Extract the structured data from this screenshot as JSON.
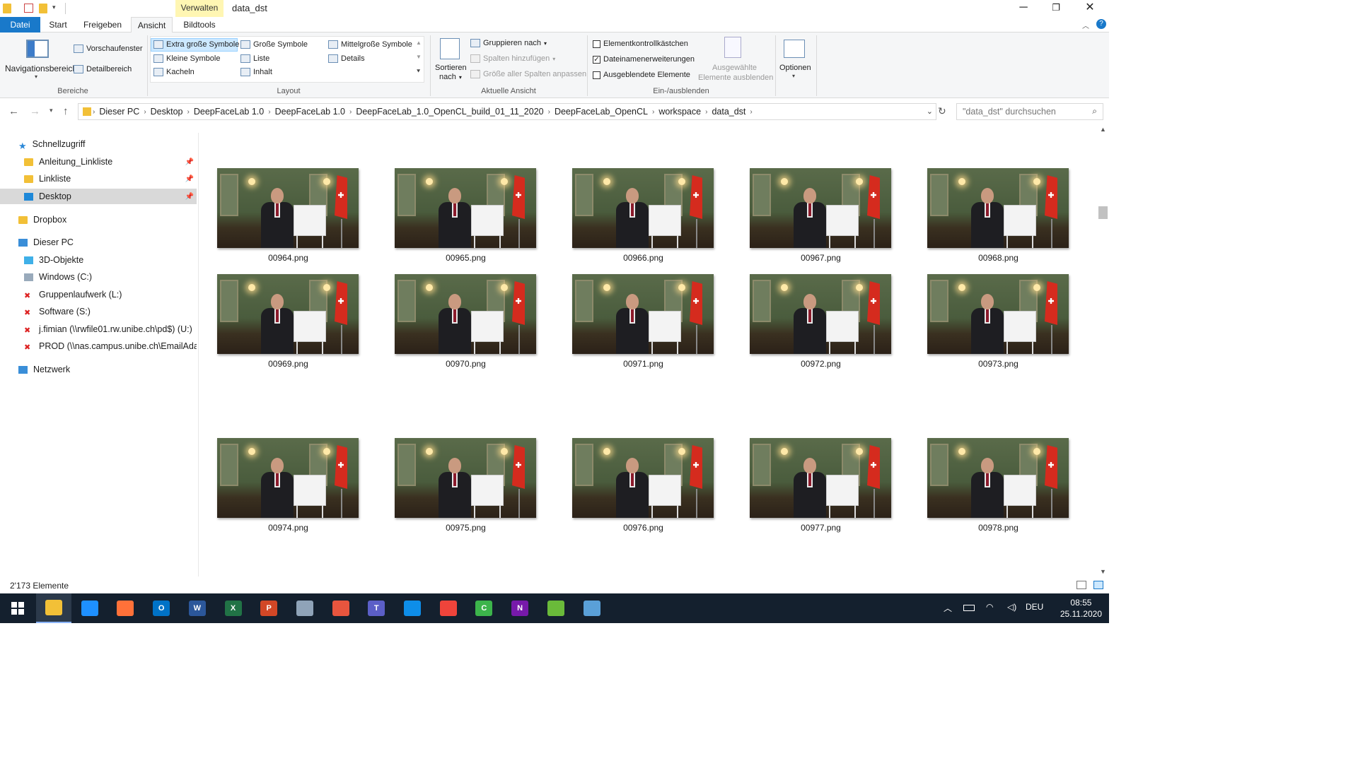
{
  "title_bar": {
    "context_group": "Verwalten",
    "window_title": "data_dst"
  },
  "tabs": [
    {
      "label": "Datei",
      "active": false
    },
    {
      "label": "Start",
      "active": false
    },
    {
      "label": "Freigeben",
      "active": false
    },
    {
      "label": "Ansicht",
      "active": true
    },
    {
      "label": "Bildtools",
      "active": false
    }
  ],
  "ribbon": {
    "panes": {
      "nav_pane": "Navigationsbereich",
      "preview": "Vorschaufenster",
      "details_pane": "Detailbereich",
      "group": "Bereiche"
    },
    "layout": {
      "options": [
        "Extra große Symbole",
        "Große Symbole",
        "Mittelgroße Symbole",
        "Kleine Symbole",
        "Liste",
        "Details",
        "Kacheln",
        "Inhalt"
      ],
      "selected": "Extra große Symbole",
      "group": "Layout"
    },
    "current_view": {
      "sort_line1": "Sortieren",
      "sort_line2": "nach",
      "group_by": "Gruppieren nach",
      "add_columns": "Spalten hinzufügen",
      "fit_columns": "Größe aller Spalten anpassen",
      "group": "Aktuelle Ansicht"
    },
    "show_hide": {
      "item_checkboxes": "Elementkontrollkästchen",
      "item_checkboxes_checked": false,
      "file_extensions": "Dateinamenerweiterungen",
      "file_extensions_checked": true,
      "hidden_items": "Ausgeblendete Elemente",
      "hidden_items_checked": false,
      "hide_selected_line1": "Ausgewählte",
      "hide_selected_line2": "Elemente ausblenden",
      "group": "Ein-/ausblenden"
    },
    "options": "Optionen"
  },
  "address": {
    "crumbs": [
      "Dieser PC",
      "Desktop",
      "DeepFaceLab 1.0",
      "DeepFaceLab 1.0",
      "DeepFaceLab_1.0_OpenCL_build_01_11_2020",
      "DeepFaceLab_OpenCL",
      "workspace",
      "data_dst"
    ],
    "search_placeholder": "\"data_dst\" durchsuchen"
  },
  "nav": {
    "quick_access": "Schnellzugriff",
    "quick_items": [
      {
        "label": "Anleitung_Linkliste",
        "icon": "folder-icon"
      },
      {
        "label": "Linkliste",
        "icon": "folder-icon"
      },
      {
        "label": "Desktop",
        "icon": "desktop-icon",
        "selected": true
      }
    ],
    "dropbox": "Dropbox",
    "this_pc": "Dieser PC",
    "pc_items": [
      {
        "label": "3D-Objekte",
        "icon": "3d-objects-icon"
      },
      {
        "label": "Windows (C:)",
        "icon": "drive-icon"
      },
      {
        "label": "Gruppenlaufwerk (L:)",
        "icon": "network-drive-disconnected-icon"
      },
      {
        "label": "Software (S:)",
        "icon": "network-drive-disconnected-icon"
      },
      {
        "label": "j.fimian (\\\\rwfile01.rw.unibe.ch\\pd$) (U:)",
        "icon": "network-drive-disconnected-icon"
      },
      {
        "label": "PROD (\\\\nas.campus.unibe.ch\\EmailAdapt",
        "icon": "network-drive-disconnected-icon"
      }
    ],
    "network": "Netzwerk"
  },
  "files": [
    "00964.png",
    "00965.png",
    "00966.png",
    "00967.png",
    "00968.png",
    "00969.png",
    "00970.png",
    "00971.png",
    "00972.png",
    "00973.png",
    "00974.png",
    "00975.png",
    "00976.png",
    "00977.png",
    "00978.png"
  ],
  "status": {
    "count": "2'173 Elemente"
  },
  "taskbar": {
    "apps": [
      {
        "name": "file-explorer",
        "color": "#f2c037",
        "active": true
      },
      {
        "name": "internet-explorer",
        "color": "#1e90ff"
      },
      {
        "name": "firefox",
        "color": "#ff7139"
      },
      {
        "name": "outlook",
        "color": "#0072c6"
      },
      {
        "name": "word",
        "color": "#2b579a"
      },
      {
        "name": "excel",
        "color": "#217346"
      },
      {
        "name": "powerpoint",
        "color": "#d24726"
      },
      {
        "name": "network-tool",
        "color": "#8fa3b8"
      },
      {
        "name": "people-app",
        "color": "#e8553e"
      },
      {
        "name": "teams",
        "color": "#5b5fc7"
      },
      {
        "name": "teamviewer",
        "color": "#0e8ee9"
      },
      {
        "name": "anydesk",
        "color": "#ef443b"
      },
      {
        "name": "camtasia",
        "color": "#3cb44b"
      },
      {
        "name": "onenote",
        "color": "#7719aa"
      },
      {
        "name": "green-plus-app",
        "color": "#6aba3a"
      },
      {
        "name": "paint-app",
        "color": "#5aa0d8"
      }
    ],
    "language": "DEU",
    "time": "08:55",
    "date": "25.11.2020"
  }
}
